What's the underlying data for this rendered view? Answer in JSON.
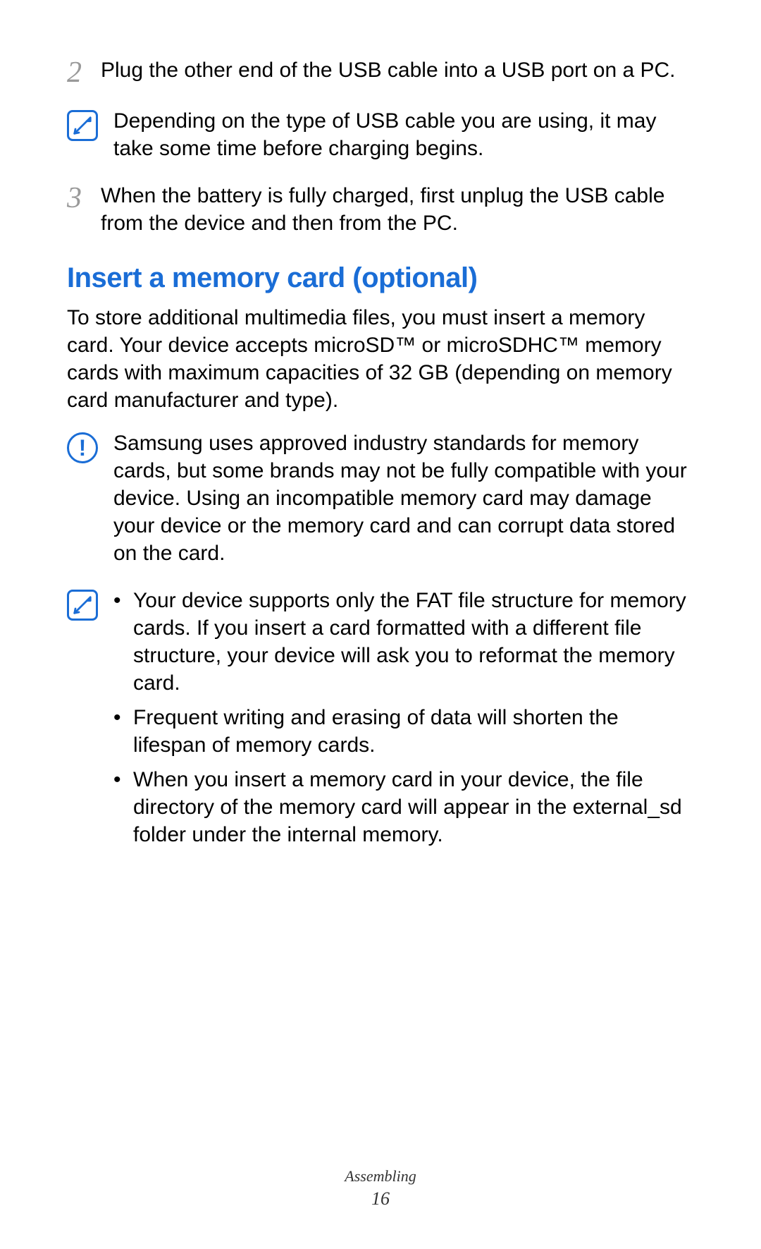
{
  "steps": {
    "s2": {
      "num": "2",
      "text": "Plug the other end of the USB cable into a USB port on a PC."
    },
    "s3": {
      "num": "3",
      "text": "When the battery is fully charged, first unplug the USB cable from the device and then from the PC."
    }
  },
  "note1": "Depending on the type of USB cable you are using, it may take some time before charging begins.",
  "heading": "Insert a memory card (optional)",
  "intro": "To store additional multimedia files, you must insert a memory card. Your device accepts microSD™ or microSDHC™ memory cards with maximum capacities of 32 GB (depending on memory card manufacturer and type).",
  "caution": "Samsung uses approved industry standards for memory cards, but some brands may not be fully compatible with your device. Using an incompatible memory card may damage your device or the memory card and can corrupt data stored on the card.",
  "bullets": {
    "b1": "Your device supports only the FAT file structure for memory cards. If you insert a card formatted with a different file structure, your device will ask you to reformat the memory card.",
    "b2": "Frequent writing and erasing of data will shorten the lifespan of memory cards.",
    "b3": "When you insert a memory card in your device, the file directory of the memory card will appear in the external_sd folder under the internal memory."
  },
  "footer": {
    "section": "Assembling",
    "page": "16"
  }
}
